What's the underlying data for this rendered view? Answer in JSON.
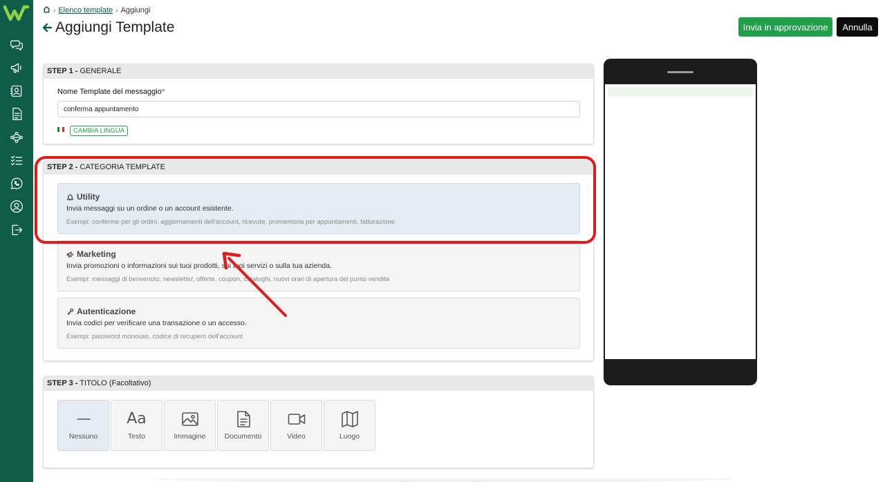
{
  "app": {
    "brand_color": "#0f5c49",
    "accent_color": "#21a04a"
  },
  "sidebar": {
    "items": [
      {
        "icon": "chat-icon"
      },
      {
        "icon": "megaphone-icon"
      },
      {
        "icon": "contacts-icon"
      },
      {
        "icon": "document-icon"
      },
      {
        "icon": "flow-icon"
      },
      {
        "icon": "checklist-icon"
      },
      {
        "icon": "whatsapp-icon"
      },
      {
        "icon": "user-icon"
      },
      {
        "icon": "logout-icon"
      }
    ]
  },
  "breadcrumb": {
    "link": "Elenco template",
    "current": "Aggiungi"
  },
  "header": {
    "title": "Aggiungi Template",
    "approve_label": "Invia in approvazione",
    "cancel_label": "Annulla"
  },
  "step1": {
    "title_bold": "STEP 1 -",
    "title_rest": " GENERALE",
    "name_label": "Nome Template del messaggio",
    "required_mark": "*",
    "name_value": "conferma appuntamento",
    "change_language_label": "CAMBIA LINGUA"
  },
  "step2": {
    "title_bold": "STEP 2 -",
    "title_rest": " CATEGORIA TEMPLATE",
    "options": [
      {
        "title": "Utility",
        "desc": "Invia messaggi su un ordine o un account esistente.",
        "example": "Esempi: conferme per gli ordini, aggiornamenti dell'account, ricevute, promemoria per appuntamenti, fatturazione",
        "selected": true
      },
      {
        "title": "Marketing",
        "desc": "Invia promozioni o informazioni sui tuoi prodotti, sui tuoi servizi o sulla tua azienda.",
        "example": "Esempi: messaggi di benvenuto, newsletter, offerte, coupon, cataloghi, nuovi orari di apertura del punto vendita",
        "selected": false
      },
      {
        "title": "Autenticazione",
        "desc": "Invia codici per verificare una transazione o un accesso.",
        "example": "Esempi: password monouso, codice di recupero dell'account",
        "selected": false
      }
    ]
  },
  "step3": {
    "title_bold": "STEP 3 -",
    "title_rest": " TITOLO (Facoltativo)",
    "options": [
      {
        "label": "Nessuno",
        "icon": "dash-icon",
        "selected": true
      },
      {
        "label": "Testo",
        "icon": "Aa",
        "selected": false
      },
      {
        "label": "Immagine",
        "icon": "image-icon",
        "selected": false
      },
      {
        "label": "Documento",
        "icon": "document-icon",
        "selected": false
      },
      {
        "label": "Video",
        "icon": "video-icon",
        "selected": false
      },
      {
        "label": "Luogo",
        "icon": "map-icon",
        "selected": false
      }
    ]
  }
}
